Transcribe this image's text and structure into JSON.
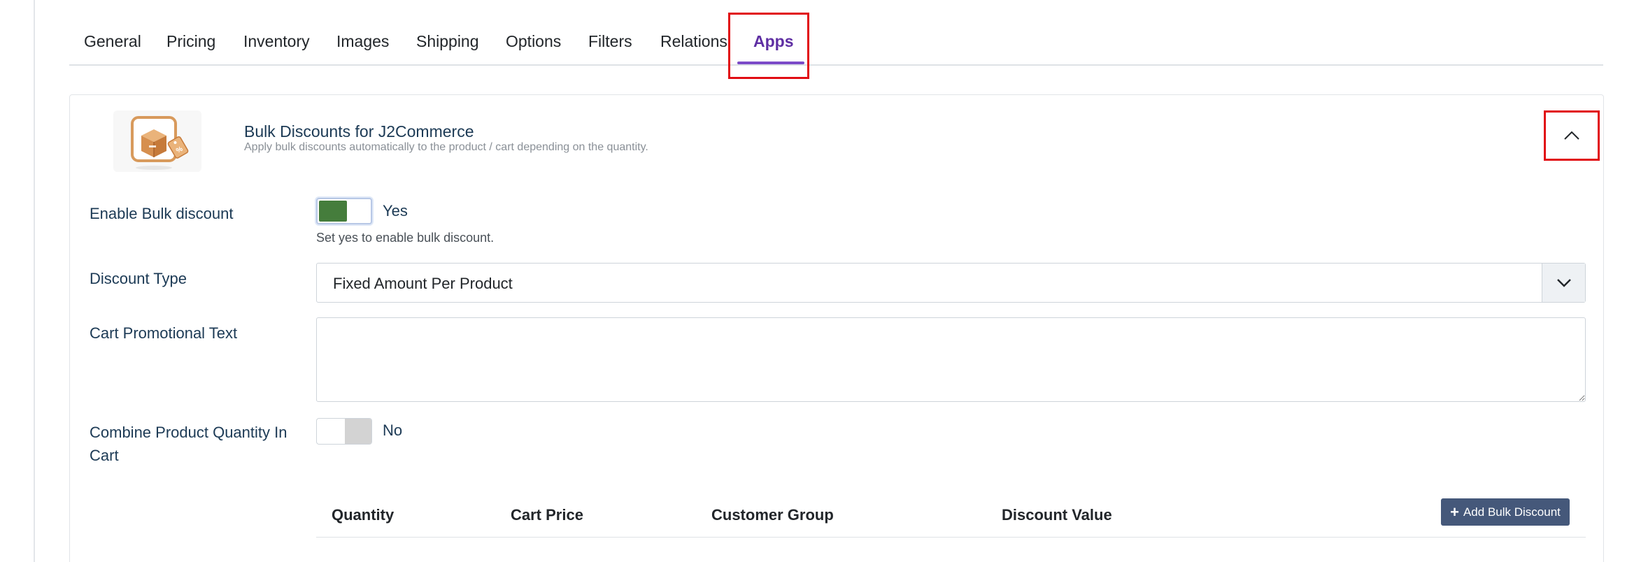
{
  "tabs": [
    {
      "label": "General"
    },
    {
      "label": "Pricing"
    },
    {
      "label": "Inventory"
    },
    {
      "label": "Images"
    },
    {
      "label": "Shipping"
    },
    {
      "label": "Options"
    },
    {
      "label": "Filters"
    },
    {
      "label": "Relations"
    },
    {
      "label": "Apps",
      "active": true
    }
  ],
  "app": {
    "title": "Bulk Discounts for J2Commerce",
    "description": "Apply bulk discounts automatically to the product / cart depending on the quantity.",
    "icon": "box-discount-icon",
    "collapse_icon": "chevron-up-icon"
  },
  "form": {
    "enable_bulk": {
      "label": "Enable Bulk discount",
      "value": "Yes",
      "help": "Set yes to enable bulk discount."
    },
    "discount_type": {
      "label": "Discount Type",
      "value": "Fixed Amount Per Product"
    },
    "cart_promo": {
      "label": "Cart Promotional Text",
      "value": ""
    },
    "combine_qty": {
      "label_line1": "Combine Product Quantity In",
      "label_line2": "Cart",
      "value": "No"
    }
  },
  "table": {
    "headers": [
      "Quantity",
      "Cart Price",
      "Customer Group",
      "Discount Value"
    ],
    "add_button": "Add Bulk Discount"
  },
  "colors": {
    "active_tab": "#5f2fa3",
    "toggle_on": "#457d3c",
    "button": "#45587a",
    "highlight": "#e10d13"
  }
}
